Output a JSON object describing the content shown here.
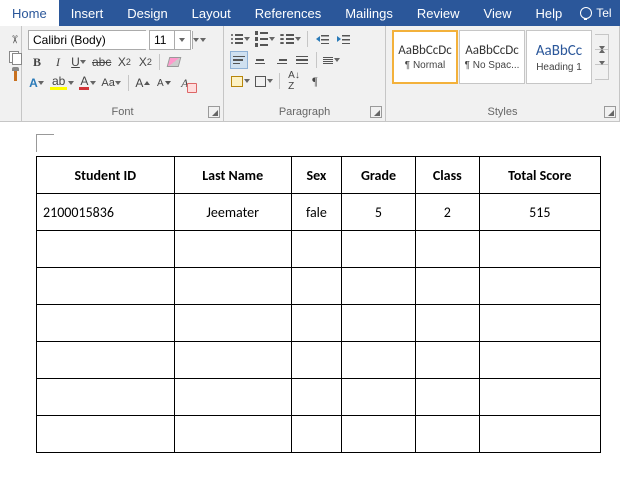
{
  "tabs": [
    "Home",
    "Insert",
    "Design",
    "Layout",
    "References",
    "Mailings",
    "Review",
    "View",
    "Help"
  ],
  "tell": "Tel",
  "font": {
    "family": "Calibri (Body)",
    "size": "11",
    "group_label": "Font"
  },
  "paragraph": {
    "group_label": "Paragraph"
  },
  "styles": {
    "group_label": "Styles",
    "items": [
      {
        "preview": "AaBbCcDc",
        "name": "¶ Normal",
        "sel": true
      },
      {
        "preview": "AaBbCcDc",
        "name": "¶ No Spac...",
        "sel": false
      },
      {
        "preview": "AaBbCc",
        "name": "Heading 1",
        "sel": false,
        "h1": true
      }
    ]
  },
  "table": {
    "headers": [
      "Student ID",
      "Last Name",
      "Sex",
      "Grade",
      "Class",
      "Total Score"
    ],
    "rows": [
      [
        "2100015836",
        "Jeemater",
        "fale",
        "5",
        "2",
        "515"
      ],
      [
        "",
        "",
        "",
        "",
        "",
        ""
      ],
      [
        "",
        "",
        "",
        "",
        "",
        ""
      ],
      [
        "",
        "",
        "",
        "",
        "",
        ""
      ],
      [
        "",
        "",
        "",
        "",
        "",
        ""
      ],
      [
        "",
        "",
        "",
        "",
        "",
        ""
      ],
      [
        "",
        "",
        "",
        "",
        "",
        ""
      ]
    ]
  }
}
